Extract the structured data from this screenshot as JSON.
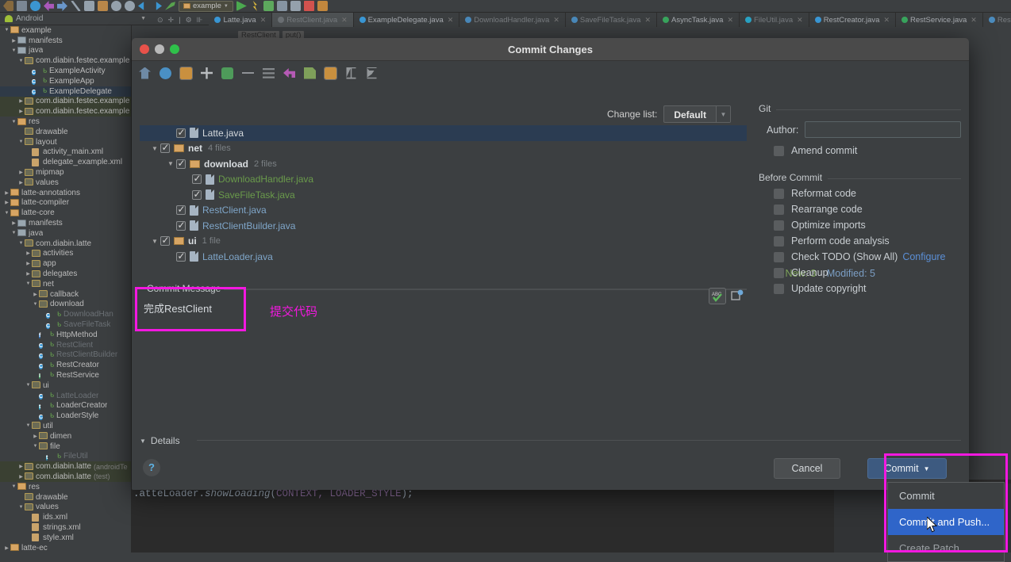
{
  "app": {
    "module_selector": "example",
    "platform_selector": "Android",
    "toolbar_icons": [
      "back-icon",
      "save-icon",
      "sync-icon",
      "undo-icon",
      "redo-icon",
      "cut-icon",
      "copy-icon",
      "paste-icon",
      "search-icon",
      "search-everywhere-icon",
      "nav-back-icon",
      "nav-forward-icon",
      "build-hammer-icon",
      "run-config-icon",
      "run-icon",
      "debug-icon",
      "attach-debugger-icon",
      "profiler-icon",
      "avd-manager-icon",
      "stop-icon",
      "sdk-manager-icon"
    ]
  },
  "tabs": [
    {
      "label": "Latte.java",
      "icon": "class-icon",
      "active": false,
      "dim": false,
      "color": "#3b9ad9"
    },
    {
      "label": "RestClient.java",
      "icon": "class-icon",
      "active": true,
      "dim": true,
      "color": "#6d7276"
    },
    {
      "label": "ExampleDelegate.java",
      "icon": "class-icon",
      "active": false,
      "dim": false,
      "color": "#3b9ad9"
    },
    {
      "label": "DownloadHandler.java",
      "icon": "class-icon",
      "active": false,
      "dim": true,
      "color": "#4b8bbd"
    },
    {
      "label": "SaveFileTask.java",
      "icon": "class-icon",
      "active": false,
      "dim": true,
      "color": "#4b8bbd"
    },
    {
      "label": "AsyncTask.java",
      "icon": "class-icon",
      "active": false,
      "dim": false,
      "color": "#3aa85f"
    },
    {
      "label": "FileUtil.java",
      "icon": "class-icon",
      "active": false,
      "dim": true,
      "color": "#2aa6c8"
    },
    {
      "label": "RestCreator.java",
      "icon": "class-icon",
      "active": false,
      "dim": false,
      "color": "#3b9ad9"
    },
    {
      "label": "RestService.java",
      "icon": "interface-icon",
      "active": false,
      "dim": false,
      "color": "#3aa85f"
    },
    {
      "label": "RestClientBuilder.java",
      "icon": "class-icon",
      "active": false,
      "dim": true,
      "color": "#4b8bbd"
    }
  ],
  "breadcrumbs": [
    "RestClient",
    "put()"
  ],
  "project_tree": [
    {
      "indent": 0,
      "arrow": "▼",
      "icon": "module-folder-icon",
      "label": "example",
      "style": "plain"
    },
    {
      "indent": 1,
      "arrow": "▶",
      "icon": "folder-blue-icon",
      "label": "manifests",
      "style": "plain"
    },
    {
      "indent": 1,
      "arrow": "▼",
      "icon": "folder-blue-icon",
      "label": "java",
      "style": "plain"
    },
    {
      "indent": 2,
      "arrow": "▼",
      "icon": "package-icon",
      "label": "com.diabin.festec.example",
      "style": "plain"
    },
    {
      "indent": 3,
      "arrow": "",
      "icon": "class-icon",
      "label": "ExampleActivity",
      "style": "plain"
    },
    {
      "indent": 3,
      "arrow": "",
      "icon": "class-icon",
      "label": "ExampleApp",
      "style": "plain"
    },
    {
      "indent": 3,
      "arrow": "",
      "icon": "class-icon",
      "label": "ExampleDelegate",
      "style": "selected"
    },
    {
      "indent": 2,
      "arrow": "▶",
      "icon": "package-icon",
      "label": "com.diabin.festec.example",
      "style": "green"
    },
    {
      "indent": 2,
      "arrow": "▶",
      "icon": "package-icon",
      "label": "com.diabin.festec.example",
      "style": "green"
    },
    {
      "indent": 1,
      "arrow": "▼",
      "icon": "res-folder-icon",
      "label": "res",
      "style": "plain"
    },
    {
      "indent": 2,
      "arrow": "",
      "icon": "package-icon",
      "label": "drawable",
      "style": "plain"
    },
    {
      "indent": 2,
      "arrow": "▼",
      "icon": "package-icon",
      "label": "layout",
      "style": "plain"
    },
    {
      "indent": 3,
      "arrow": "",
      "icon": "xml-file-icon",
      "label": "activity_main.xml",
      "style": "plain"
    },
    {
      "indent": 3,
      "arrow": "",
      "icon": "xml-file-icon",
      "label": "delegate_example.xml",
      "style": "plain"
    },
    {
      "indent": 2,
      "arrow": "▶",
      "icon": "package-icon",
      "label": "mipmap",
      "style": "plain"
    },
    {
      "indent": 2,
      "arrow": "▶",
      "icon": "package-icon",
      "label": "values",
      "style": "plain"
    },
    {
      "indent": 0,
      "arrow": "▶",
      "icon": "module-folder-icon",
      "label": "latte-annotations",
      "style": "plain"
    },
    {
      "indent": 0,
      "arrow": "▶",
      "icon": "module-folder-icon",
      "label": "latte-compiler",
      "style": "plain"
    },
    {
      "indent": 0,
      "arrow": "▼",
      "icon": "module-folder-icon",
      "label": "latte-core",
      "style": "plain"
    },
    {
      "indent": 1,
      "arrow": "▶",
      "icon": "folder-blue-icon",
      "label": "manifests",
      "style": "plain"
    },
    {
      "indent": 1,
      "arrow": "▼",
      "icon": "folder-blue-icon",
      "label": "java",
      "style": "plain"
    },
    {
      "indent": 2,
      "arrow": "▼",
      "icon": "package-icon",
      "label": "com.diabin.latte",
      "style": "plain"
    },
    {
      "indent": 3,
      "arrow": "▶",
      "icon": "package-icon",
      "label": "activities",
      "style": "plain"
    },
    {
      "indent": 3,
      "arrow": "▶",
      "icon": "package-icon",
      "label": "app",
      "style": "plain"
    },
    {
      "indent": 3,
      "arrow": "▶",
      "icon": "package-icon",
      "label": "delegates",
      "style": "plain"
    },
    {
      "indent": 3,
      "arrow": "▼",
      "icon": "package-icon",
      "label": "net",
      "style": "plain"
    },
    {
      "indent": 4,
      "arrow": "▶",
      "icon": "package-icon",
      "label": "callback",
      "style": "plain"
    },
    {
      "indent": 4,
      "arrow": "▼",
      "icon": "package-icon",
      "label": "download",
      "style": "plain"
    },
    {
      "indent": 5,
      "arrow": "",
      "icon": "class-icon",
      "label": "DownloadHan",
      "style": "muted"
    },
    {
      "indent": 5,
      "arrow": "",
      "icon": "class-icon",
      "label": "SaveFileTask",
      "style": "muted"
    },
    {
      "indent": 4,
      "arrow": "",
      "icon": "field-icon",
      "label": "HttpMethod",
      "style": "plain"
    },
    {
      "indent": 4,
      "arrow": "",
      "icon": "class-icon",
      "label": "RestClient",
      "style": "muted"
    },
    {
      "indent": 4,
      "arrow": "",
      "icon": "class-icon",
      "label": "RestClientBuilder",
      "style": "muted"
    },
    {
      "indent": 4,
      "arrow": "",
      "icon": "class-icon",
      "label": "RestCreator",
      "style": "plain"
    },
    {
      "indent": 4,
      "arrow": "",
      "icon": "interface-icon",
      "label": "RestService",
      "style": "plain"
    },
    {
      "indent": 3,
      "arrow": "▼",
      "icon": "package-icon",
      "label": "ui",
      "style": "plain"
    },
    {
      "indent": 4,
      "arrow": "",
      "icon": "class-icon",
      "label": "LatteLoader",
      "style": "muted"
    },
    {
      "indent": 4,
      "arrow": "",
      "icon": "theme-icon",
      "label": "LoaderCreator",
      "style": "plain"
    },
    {
      "indent": 4,
      "arrow": "",
      "icon": "class-icon",
      "label": "LoaderStyle",
      "style": "plain"
    },
    {
      "indent": 3,
      "arrow": "▼",
      "icon": "package-icon",
      "label": "util",
      "style": "plain"
    },
    {
      "indent": 4,
      "arrow": "▶",
      "icon": "package-icon",
      "label": "dimen",
      "style": "plain"
    },
    {
      "indent": 4,
      "arrow": "▼",
      "icon": "package-icon",
      "label": "file",
      "style": "plain"
    },
    {
      "indent": 5,
      "arrow": "",
      "icon": "theme-icon",
      "label": "FileUtil",
      "style": "muted"
    },
    {
      "indent": 2,
      "arrow": "▶",
      "icon": "package-icon",
      "label": "com.diabin.latte",
      "sub": "(androidTe",
      "style": "green"
    },
    {
      "indent": 2,
      "arrow": "▶",
      "icon": "package-icon",
      "label": "com.diabin.latte",
      "sub": "(test)",
      "style": "green"
    },
    {
      "indent": 1,
      "arrow": "▼",
      "icon": "res-folder-icon",
      "label": "res",
      "style": "plain"
    },
    {
      "indent": 2,
      "arrow": "",
      "icon": "package-icon",
      "label": "drawable",
      "style": "plain"
    },
    {
      "indent": 2,
      "arrow": "▼",
      "icon": "package-icon",
      "label": "values",
      "style": "plain"
    },
    {
      "indent": 3,
      "arrow": "",
      "icon": "xml-file-icon",
      "label": "ids.xml",
      "style": "plain"
    },
    {
      "indent": 3,
      "arrow": "",
      "icon": "xml-file-icon",
      "label": "strings.xml",
      "style": "plain"
    },
    {
      "indent": 3,
      "arrow": "",
      "icon": "xml-file-icon",
      "label": "style.xml",
      "style": "plain"
    },
    {
      "indent": 0,
      "arrow": "▶",
      "icon": "module-folder-icon",
      "label": "latte-ec",
      "style": "plain"
    }
  ],
  "dialog": {
    "title": "Commit Changes",
    "toolbar_icons": [
      "rollback-icon",
      "refresh-icon",
      "show-diff-icon",
      "add-icon",
      "move-to-changelist-icon",
      "delete-icon",
      "group-by-icon",
      "revert-icon",
      "edit-source-icon",
      "lock-icon",
      "expand-all-icon",
      "collapse-all-icon"
    ],
    "change_list_label": "Change list:",
    "change_list_value": "Default",
    "files": [
      {
        "indent": 2,
        "triangle": "",
        "type": "file",
        "label": "Latte.java",
        "color": "white",
        "selected": true
      },
      {
        "indent": 1,
        "triangle": "▼",
        "type": "dir",
        "label": "net",
        "count": "4 files",
        "color": "folder"
      },
      {
        "indent": 2,
        "triangle": "▼",
        "type": "dir",
        "label": "download",
        "count": "2 files",
        "color": "folder"
      },
      {
        "indent": 3,
        "triangle": "",
        "type": "file",
        "label": "DownloadHandler.java",
        "color": "green"
      },
      {
        "indent": 3,
        "triangle": "",
        "type": "file",
        "label": "SaveFileTask.java",
        "color": "green"
      },
      {
        "indent": 2,
        "triangle": "",
        "type": "file",
        "label": "RestClient.java",
        "color": "blue"
      },
      {
        "indent": 2,
        "triangle": "",
        "type": "file",
        "label": "RestClientBuilder.java",
        "color": "blue"
      },
      {
        "indent": 1,
        "triangle": "▼",
        "type": "dir",
        "label": "ui",
        "count": "1 file",
        "color": "folder"
      },
      {
        "indent": 2,
        "triangle": "",
        "type": "file",
        "label": "LatteLoader.java",
        "color": "blue"
      }
    ],
    "counts": {
      "new_label": "New: 3",
      "modified_label": "Modified: 5"
    },
    "commit_message": {
      "legend": "Commit Message",
      "value": "完成RestClient",
      "icons": [
        "spellcheck-icon",
        "message-history-icon"
      ]
    },
    "annotation_note": "提交代码",
    "git": {
      "group_title": "Git",
      "author_label": "Author:",
      "author_value": "",
      "amend_label": "Amend commit"
    },
    "before_commit": {
      "group_title": "Before Commit",
      "options": [
        {
          "label": "Reformat code"
        },
        {
          "label": "Rearrange code"
        },
        {
          "label": "Optimize imports"
        },
        {
          "label": "Perform code analysis"
        },
        {
          "label": "Check TODO (Show All)",
          "link": "Configure"
        },
        {
          "label": "Cleanup"
        },
        {
          "label": "Update copyright"
        }
      ]
    },
    "details_label": "Details",
    "help_label": "?",
    "cancel_label": "Cancel",
    "commit_label": "Commit",
    "commit_menu": [
      {
        "label": "Commit",
        "highlighted": false
      },
      {
        "label": "Commit and Push...",
        "highlighted": true
      },
      {
        "label": "Create Patch...",
        "highlighted": false
      }
    ]
  },
  "editor": {
    "line": "LatteLoader.showLoading(CONTEXT, LOADER_STYLE);",
    "prefix": ".atteLoader.",
    "method": "showLoading",
    "args": "CONTEXT, LOADER_STYLE"
  },
  "colors": {
    "accent_pink": "#f318e0",
    "selection_blue": "#2f65c9",
    "commit_button": "#3d5a80",
    "new_green": "#7ea45a",
    "modified_blue": "#7b9ec4"
  }
}
